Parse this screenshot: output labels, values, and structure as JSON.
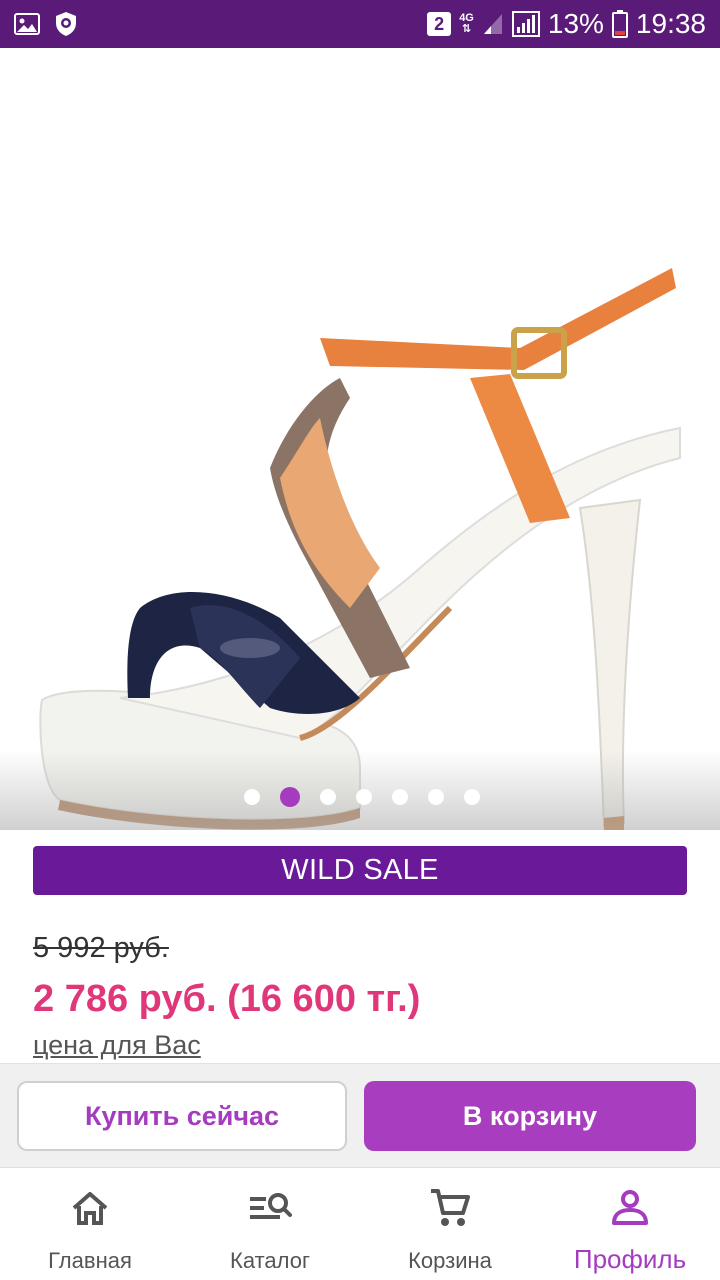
{
  "status_bar": {
    "sim_slot": "2",
    "network_type": "4G",
    "battery_percent": "13%",
    "time": "19:38",
    "left_icons": [
      "gallery-icon",
      "lion-shield-icon"
    ]
  },
  "gallery": {
    "image_alt": "sandal",
    "total_slides": 7,
    "active_slide_index": 1
  },
  "sale_banner": {
    "label": "WILD SALE"
  },
  "prices": {
    "old_price": "5 992 руб.",
    "new_price": "2 786 руб.  (16 600 тг.)",
    "price_note": "цена для Вас"
  },
  "actions": {
    "buy_now_label": "Купить сейчас",
    "add_to_cart_label": "В корзину"
  },
  "bottom_nav": {
    "items": [
      {
        "label": "Главная",
        "icon": "home-icon"
      },
      {
        "label": "Каталог",
        "icon": "catalog-search-icon"
      },
      {
        "label": "Корзина",
        "icon": "cart-icon"
      },
      {
        "label": "Профиль",
        "icon": "profile-icon"
      }
    ],
    "active_index": 3
  },
  "colors": {
    "status_bar": "#5a1a78",
    "sale_banner": "#6a1a98",
    "accent_purple": "#a83ebf",
    "price_pink": "#e0367a"
  }
}
